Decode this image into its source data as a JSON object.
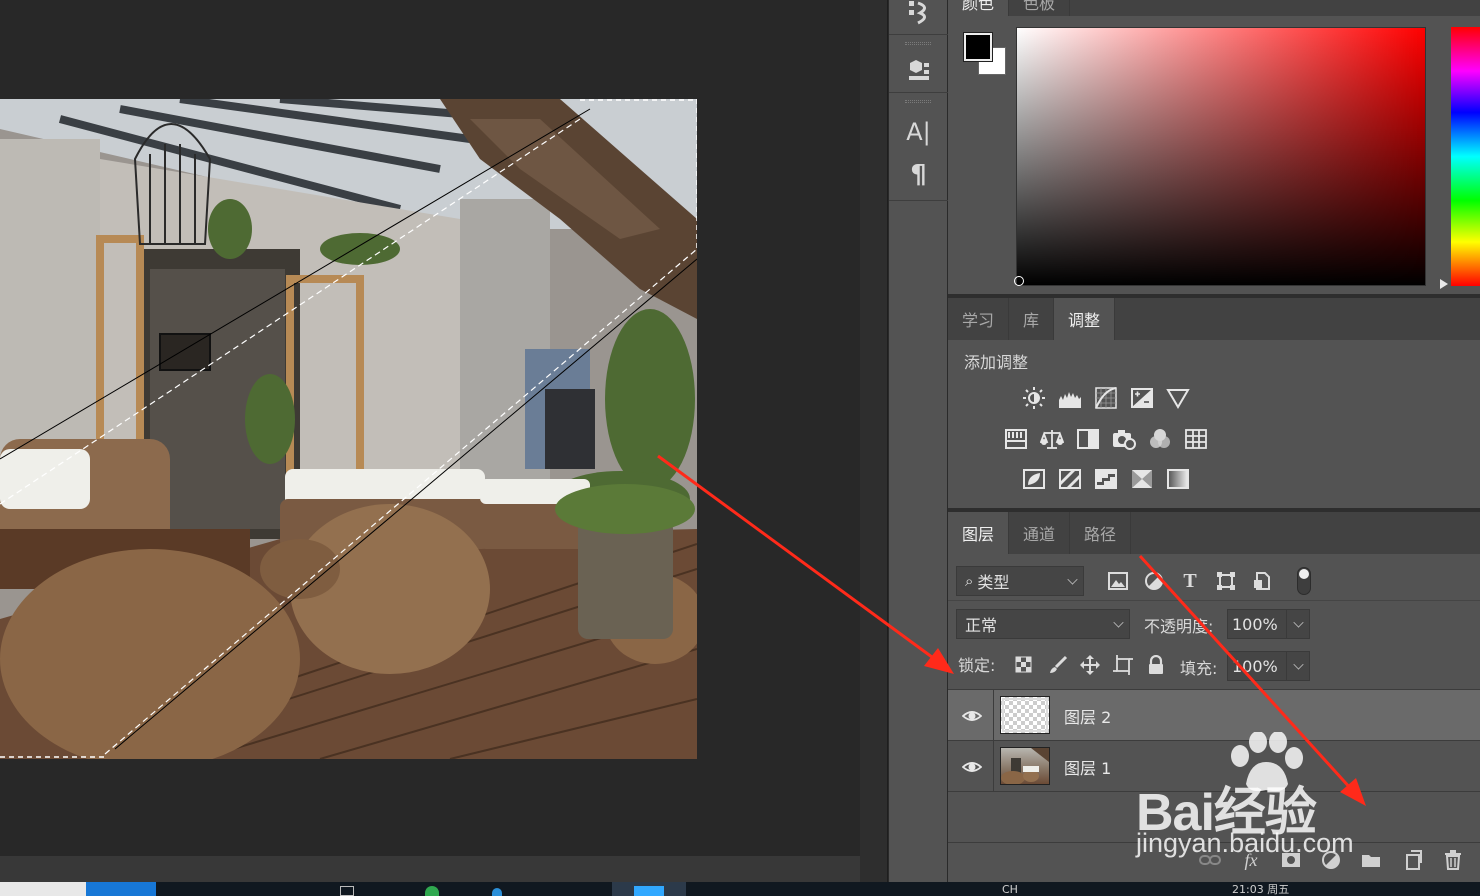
{
  "color_panel": {
    "tabs": [
      "颜色",
      "色板"
    ],
    "foreground": "#000000",
    "background": "#ffffff"
  },
  "tool_strip": {
    "icons": [
      "history-icon",
      "3d-icon",
      "character-icon",
      "paragraph-icon"
    ],
    "character_glyph": "A|",
    "paragraph_glyph": "¶"
  },
  "adjust_panel": {
    "tabs": [
      "学习",
      "库",
      "调整"
    ],
    "active_tab": "调整",
    "heading": "添加调整",
    "rows": [
      [
        "brightness-contrast-icon",
        "levels-icon",
        "curves-icon",
        "exposure-icon",
        "vibrance-icon"
      ],
      [
        "hue-saturation-icon",
        "color-balance-icon",
        "black-white-icon",
        "photo-filter-icon",
        "channel-mixer-icon",
        "color-lookup-icon"
      ],
      [
        "invert-icon",
        "posterize-icon",
        "threshold-icon",
        "selective-color-icon",
        "gradient-map-icon"
      ]
    ]
  },
  "layers_panel": {
    "tabs": [
      "图层",
      "通道",
      "路径"
    ],
    "active_tab": "图层",
    "filter_label": "类型",
    "blend_mode": "正常",
    "opacity_label": "不透明度:",
    "opacity_value": "100%",
    "lock_label": "锁定:",
    "fill_label": "填充:",
    "fill_value": "100%",
    "layers": [
      {
        "name": "图层 2",
        "selected": true,
        "visible": true,
        "thumbnail": "transparent"
      },
      {
        "name": "图层 1",
        "selected": false,
        "visible": true,
        "thumbnail": "photo"
      }
    ],
    "footer_icons": [
      "link-icon",
      "fx-icon",
      "mask-icon",
      "adjustment-layer-icon",
      "group-icon",
      "new-layer-icon",
      "trash-icon"
    ]
  },
  "watermark": {
    "main": "Bai经验",
    "sub": "jingyan.baidu.com"
  },
  "taskbar": {
    "ime": "CH",
    "clock_fragment": "21:03 周五"
  },
  "colors": {
    "panel_bg": "#535353",
    "tab_bar": "#424242",
    "canvas_bg": "#282828",
    "annotation_arrow": "#ff2a1a"
  }
}
